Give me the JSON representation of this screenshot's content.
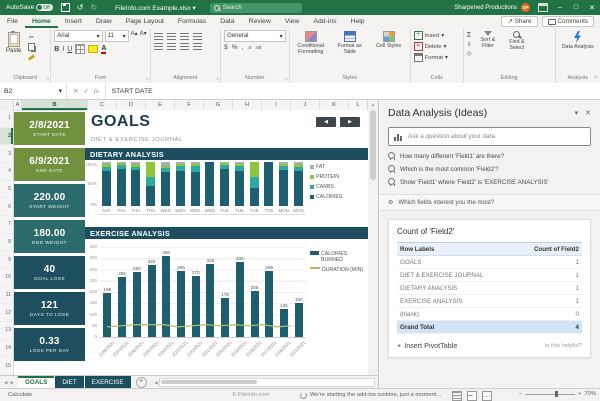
{
  "window": {
    "autosave_label": "AutoSave",
    "autosave_state": "Off",
    "filename": "FileInfo.com Example.xlsx",
    "search_placeholder": "Search",
    "account_name": "Sharpened Productions",
    "account_initials": "SP"
  },
  "menu": {
    "tabs": [
      "File",
      "Home",
      "Insert",
      "Draw",
      "Page Layout",
      "Formulas",
      "Data",
      "Review",
      "View",
      "Add-ins",
      "Help"
    ],
    "active": "Home",
    "share": "Share",
    "comments": "Comments"
  },
  "ribbon": {
    "groups": [
      "Clipboard",
      "Font",
      "Alignment",
      "Number",
      "Styles",
      "Cells",
      "Editing",
      "Analysis"
    ],
    "paste_label": "Paste",
    "font_name": "Arial",
    "font_size": "11",
    "number_format": "General",
    "conditional_formatting_label": "Conditional Formatting",
    "format_as_table_label": "Format as Table",
    "cell_styles_label": "Cell Styles",
    "insert_label": "Insert",
    "delete_label": "Delete",
    "format_label": "Format",
    "sort_filter_label": "Sort & Filter",
    "find_select_label": "Find & Select",
    "data_analysis_label": "Data Analysis"
  },
  "formula_bar": {
    "name_box": "B2",
    "content": "START DATE"
  },
  "grid": {
    "columns": [
      "A",
      "B",
      "C",
      "D",
      "E",
      "F",
      "G",
      "H",
      "I",
      "J",
      "K",
      "L"
    ],
    "row_count": 15,
    "selected_column": "B",
    "selected_row": 2
  },
  "sheet": {
    "title": "GOALS",
    "subtitle": "DIET & EXERCISE JOURNAL",
    "stats": [
      {
        "value": "2/8/2021",
        "label": "START DATE",
        "bg": "#72913e"
      },
      {
        "value": "6/9/2021",
        "label": "END DATE",
        "bg": "#72913e"
      },
      {
        "value": "220.00",
        "label": "START WEIGHT",
        "bg": "#2b6b6e"
      },
      {
        "value": "180.00",
        "label": "END WEIGHT",
        "bg": "#2b6b6e"
      },
      {
        "value": "40",
        "label": "GOAL LOSS",
        "bg": "#1e4f5e"
      },
      {
        "value": "121",
        "label": "DAYS TO LOSE",
        "bg": "#1e4f5e"
      },
      {
        "value": "0.33",
        "label": "LOSS PER DAY",
        "bg": "#1e4f5e"
      }
    ]
  },
  "chart_data": [
    {
      "type": "bar",
      "stacked": true,
      "percent": true,
      "title": "DIETARY ANALYSIS",
      "categories": [
        "SAT",
        "THU",
        "THU",
        "THU",
        "WED",
        "WED",
        "WED",
        "WED",
        "TUE",
        "TUE",
        "TUE",
        "TUE",
        "MON",
        "MON"
      ],
      "series": [
        {
          "name": "FAT",
          "color": "#a8adb3",
          "values": [
            4,
            3,
            4,
            0,
            8,
            5,
            4,
            0,
            3,
            4,
            0,
            0,
            4,
            4
          ]
        },
        {
          "name": "PROTEIN",
          "color": "#8dc63f",
          "values": [
            8,
            4,
            8,
            35,
            5,
            5,
            6,
            0,
            4,
            6,
            35,
            0,
            6,
            8
          ]
        },
        {
          "name": "CARBS",
          "color": "#2fa8a0",
          "values": [
            8,
            8,
            6,
            20,
            10,
            10,
            12,
            0,
            8,
            10,
            25,
            0,
            8,
            8
          ]
        },
        {
          "name": "CALORIES",
          "color": "#1d5f6e",
          "values": [
            80,
            85,
            82,
            45,
            77,
            80,
            78,
            100,
            85,
            80,
            40,
            100,
            82,
            80
          ]
        }
      ],
      "yticks": [
        "100%",
        "50%",
        "0%"
      ],
      "legend_position": "right"
    },
    {
      "type": "bar",
      "title": "EXERCISE ANALYSIS",
      "categories": [
        "2/28/2021",
        "2/27/2021",
        "2/26/2021",
        "2/25/2021",
        "2/24/2021",
        "2/23/2021",
        "2/22/2021",
        "2/21/2021",
        "2/20/2021",
        "2/19/2021",
        "2/18/2021",
        "2/17/2021",
        "2/16/2021",
        "2/15/2021"
      ],
      "series": [
        {
          "name": "CALORIES BURNED",
          "type": "bar",
          "color": "#1d5f6e",
          "values": [
            195,
            265,
            290,
            320,
            360,
            295,
            270,
            325,
            175,
            335,
            205,
            295,
            125,
            150
          ]
        },
        {
          "name": "DURATION (MIN)",
          "type": "line",
          "color": "#b9bd6a",
          "values": [
            45,
            50,
            55,
            55,
            55,
            45,
            50,
            55,
            50,
            55,
            50,
            55,
            45,
            50
          ]
        }
      ],
      "ylim": [
        0,
        400
      ],
      "yticks": [
        "400",
        "350",
        "300",
        "250",
        "200",
        "150",
        "100",
        "50",
        "0"
      ],
      "grid": true,
      "legend_position": "right"
    }
  ],
  "pane": {
    "title": "Data Analysis (Ideas)",
    "search_placeholder": "Ask a question about your data",
    "suggestions": [
      "How many different 'Field1' are there?",
      "Which is the most common 'Field2'?",
      "Show 'Field1' where 'Field2' is 'EXERCISE ANALYSIS'"
    ],
    "fields_prompt": "Which fields interest you the most?",
    "card": {
      "title": "Count of 'Field2'",
      "columns": [
        "Row Labels",
        "Count of Field2"
      ],
      "rows": [
        [
          "GOALS",
          "1"
        ],
        [
          "DIET & EXERCISE JOURNAL",
          "1"
        ],
        [
          "DIETARY ANALYSIS",
          "1"
        ],
        [
          "EXERCISE ANALYSIS",
          "1"
        ],
        [
          "(blank)",
          "0"
        ]
      ],
      "grand_total": [
        "Grand Total",
        "4"
      ],
      "insert_link": "Insert PivotTable",
      "helpful_label": "Is this helpful?"
    }
  },
  "sheet_tabs": {
    "tabs": [
      {
        "name": "GOALS",
        "active": true,
        "bg": "#ffffff"
      },
      {
        "name": "DIET",
        "active": false,
        "bg": "#1d4e5f"
      },
      {
        "name": "EXERCISE",
        "active": false,
        "bg": "#1d4e5f"
      }
    ]
  },
  "status_bar": {
    "calculate": "Calculate",
    "copyright": "© FileInfo.com",
    "addin_message": "We're starting the add-ins runtime, just a moment...",
    "zoom_level": "70%"
  },
  "icons": {
    "dropdown": "▾",
    "undo": "↺",
    "redo": "↻",
    "minimize": "–",
    "maximize": "□",
    "close": "✕",
    "prev": "◀",
    "next": "▶",
    "cancel": "✕",
    "enter": "✓",
    "fx": "fx",
    "sigma": "Σ",
    "gear": "⚙",
    "share": "↗",
    "add": "+",
    "collapse": "^",
    "bold": "B",
    "italic": "I",
    "underline": "U",
    "font-increase": "A▴",
    "font-decrease": "A▾",
    "dollar": "$",
    "percent": "%",
    "comma": ",",
    "dec-inc": ".0",
    "dec-dec": ".00",
    "up-arrow": "▲",
    "left-arrow": "◀",
    "right-arrow": "▶",
    "launcher": "↘",
    "lightning": "⚡"
  }
}
